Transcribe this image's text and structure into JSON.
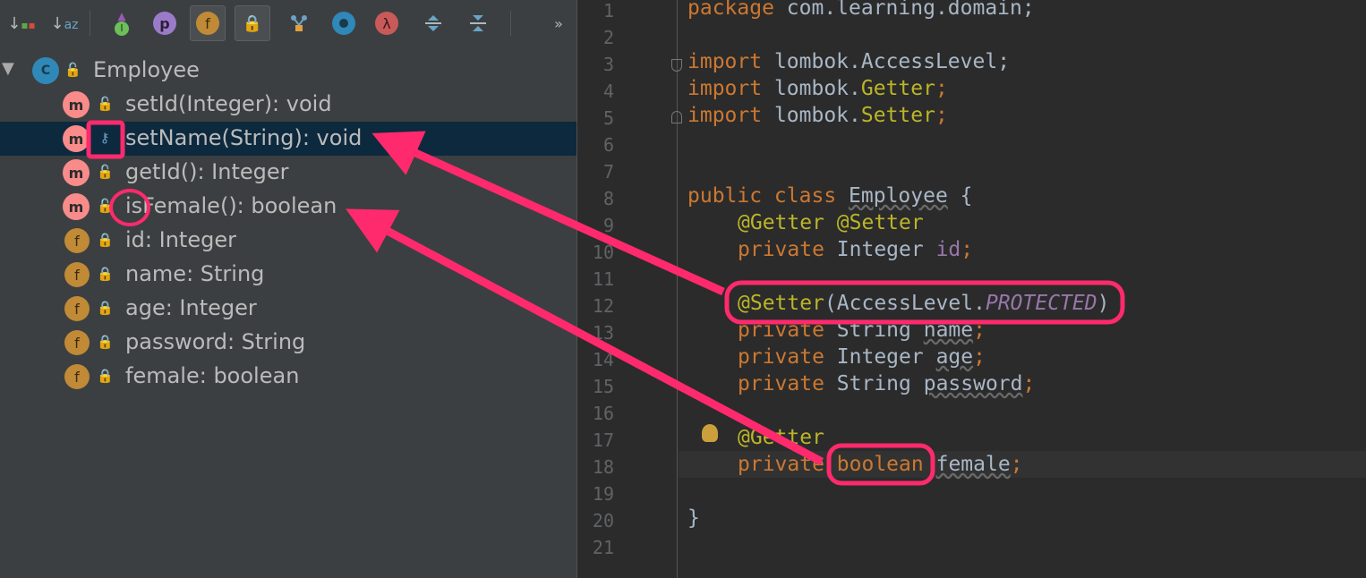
{
  "structure": {
    "toolbar": {
      "sort_by_visibility": "↓",
      "sort_alpha": "↓az",
      "inherited": "I",
      "properties": "p",
      "fields": "f",
      "non_public": "🔒",
      "lambda": "λ",
      "more": "»"
    },
    "class_icon": "C",
    "class_name": "Employee",
    "members": [
      {
        "icon": "m",
        "label": "setId(Integer): void"
      },
      {
        "icon": "m",
        "label": "setName(String): void"
      },
      {
        "icon": "m",
        "label": "getId(): Integer"
      },
      {
        "icon": "m",
        "label": "isFemale(): boolean"
      },
      {
        "icon": "f",
        "label": "id: Integer"
      },
      {
        "icon": "f",
        "label": "name: String"
      },
      {
        "icon": "f",
        "label": "age: Integer"
      },
      {
        "icon": "f",
        "label": "password: String"
      },
      {
        "icon": "f",
        "label": "female: boolean"
      }
    ]
  },
  "editor": {
    "line_numbers": [
      "1",
      "2",
      "3",
      "4",
      "5",
      "6",
      "7",
      "8",
      "9",
      "10",
      "11",
      "12",
      "13",
      "14",
      "15",
      "16",
      "17",
      "18",
      "19",
      "20",
      "21"
    ],
    "lines": {
      "l1": {
        "kw": "package",
        "rest": " com.learning.domain;"
      },
      "l3": {
        "kw": "import",
        "rest": " lombok.AccessLevel;"
      },
      "l4": {
        "kw": "import",
        "rest1": " lombok.",
        "ann": "Getter",
        "rest2": ";"
      },
      "l5": {
        "kw": "import",
        "rest1": " lombok.",
        "ann": "Setter",
        "rest2": ";"
      },
      "l8": {
        "kw": "public class",
        "name": "Employee",
        "rest": " {"
      },
      "l9": {
        "a1": "@Getter",
        "a2": "@Setter"
      },
      "l10": {
        "kw": "private",
        "type": " Integer ",
        "field": "id",
        "end": ";"
      },
      "l12": {
        "ann": "@Setter",
        "p1": "(AccessLevel.",
        "const": "PROTECTED",
        "p2": ")"
      },
      "l13": {
        "kw": "private",
        "type": " String ",
        "field": "name",
        "end": ";"
      },
      "l14": {
        "kw": "private",
        "type": " Integer ",
        "field": "age",
        "end": ";"
      },
      "l15": {
        "kw": "private",
        "type": " String ",
        "field": "password",
        "end": ";"
      },
      "l17": {
        "ann": "@Getter"
      },
      "l18": {
        "kw": "private",
        "type": "boolean",
        "field": "female",
        "end": ";"
      },
      "l20": {
        "brace": "}"
      }
    }
  }
}
